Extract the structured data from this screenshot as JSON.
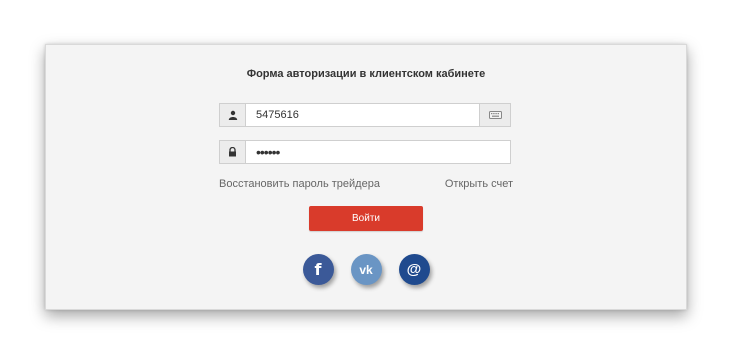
{
  "form": {
    "title": "Форма авторизации в клиентском кабинете",
    "login_value": "5475616",
    "password_value": "••••••",
    "restore_link": "Восстановить пароль трейдера",
    "open_account_link": "Открыть счет",
    "submit_label": "Войти"
  },
  "icons": {
    "login_addon": "user-icon",
    "password_addon": "lock-icon",
    "keyboard": "keyboard-icon"
  },
  "social": [
    {
      "name": "facebook",
      "glyph": "f",
      "color": "#3b5998"
    },
    {
      "name": "vk",
      "glyph": "vk",
      "color": "#6a95c4"
    },
    {
      "name": "mail",
      "glyph": "@",
      "color": "#1f4a8e"
    }
  ],
  "colors": {
    "accent": "#d93b2b",
    "panel_bg": "#f4f4f4"
  }
}
